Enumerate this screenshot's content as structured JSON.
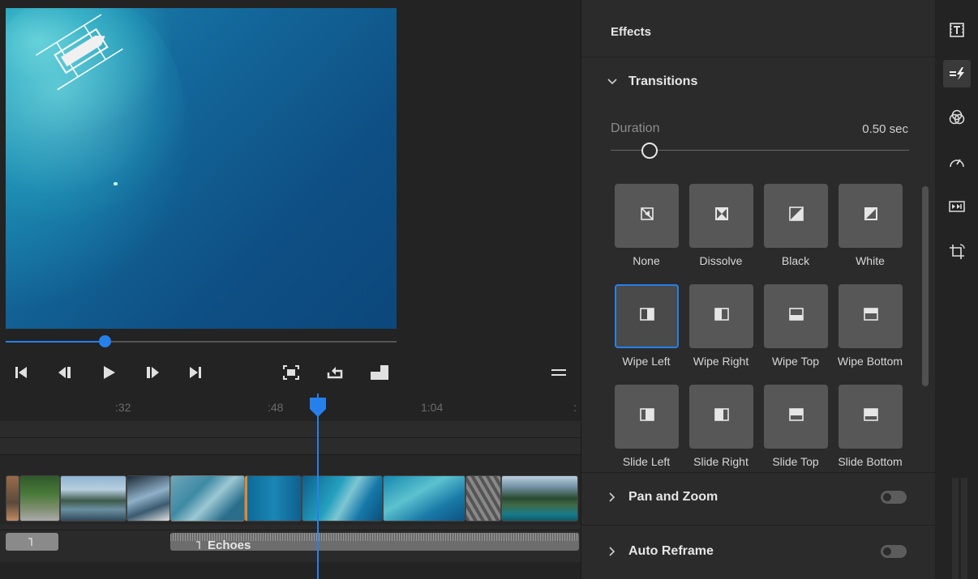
{
  "player": {
    "progress": 0.255
  },
  "timeline": {
    "ruler": [
      ":32",
      ":48",
      "1:04"
    ],
    "audio_clip_label": "Echoes"
  },
  "effects": {
    "title": "Effects",
    "transitions": {
      "label": "Transitions",
      "duration_label": "Duration",
      "duration_value": "0.50 sec",
      "duration_slider": 0.1,
      "items": [
        {
          "label": "None"
        },
        {
          "label": "Dissolve"
        },
        {
          "label": "Black"
        },
        {
          "label": "White"
        },
        {
          "label": "Wipe Left",
          "selected": true
        },
        {
          "label": "Wipe Right"
        },
        {
          "label": "Wipe Top"
        },
        {
          "label": "Wipe Bottom"
        },
        {
          "label": "Slide Left"
        },
        {
          "label": "Slide Right"
        },
        {
          "label": "Slide Top"
        },
        {
          "label": "Slide Bottom"
        }
      ]
    },
    "pan_zoom": {
      "label": "Pan and Zoom",
      "enabled": false
    },
    "auto_reframe": {
      "label": "Auto Reframe",
      "enabled": false
    }
  },
  "toolbar": {
    "tools": [
      "titles-icon",
      "transitions-icon",
      "color-icon",
      "speed-icon",
      "motion-icon",
      "crop-icon"
    ],
    "active": "transitions-icon"
  },
  "colors": {
    "accent": "#2680eb",
    "panel": "#2b2b2b",
    "tile": "#575757"
  }
}
